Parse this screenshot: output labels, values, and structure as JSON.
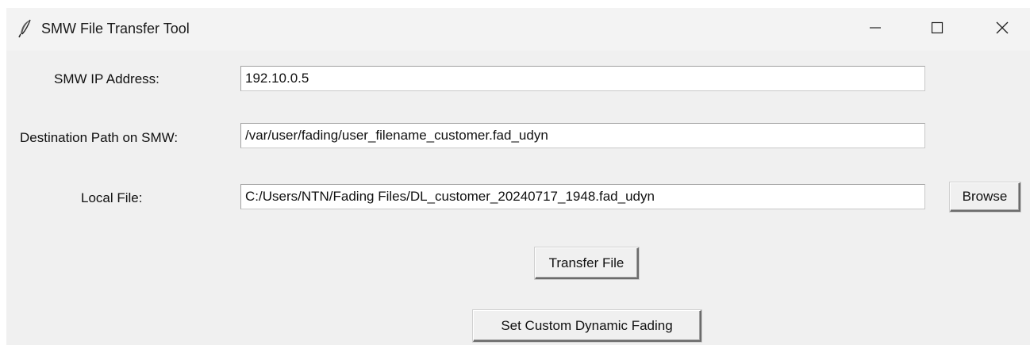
{
  "window": {
    "title": "SMW File Transfer Tool",
    "icon": "feather-icon",
    "controls": [
      "minimize-icon",
      "maximize-icon",
      "close-icon"
    ]
  },
  "form": {
    "ip_label": "SMW IP Address:",
    "ip_value": "192.10.0.5",
    "dest_label": "Destination Path on SMW:",
    "dest_value": "/var/user/fading/user_filename_customer.fad_udyn",
    "local_label": "Local File:",
    "local_value": "C:/Users/NTN/Fading Files/DL_customer_20240717_1948.fad_udyn",
    "browse_label": "Browse",
    "transfer_label": "Transfer File",
    "fading_label": "Set Custom Dynamic Fading"
  }
}
